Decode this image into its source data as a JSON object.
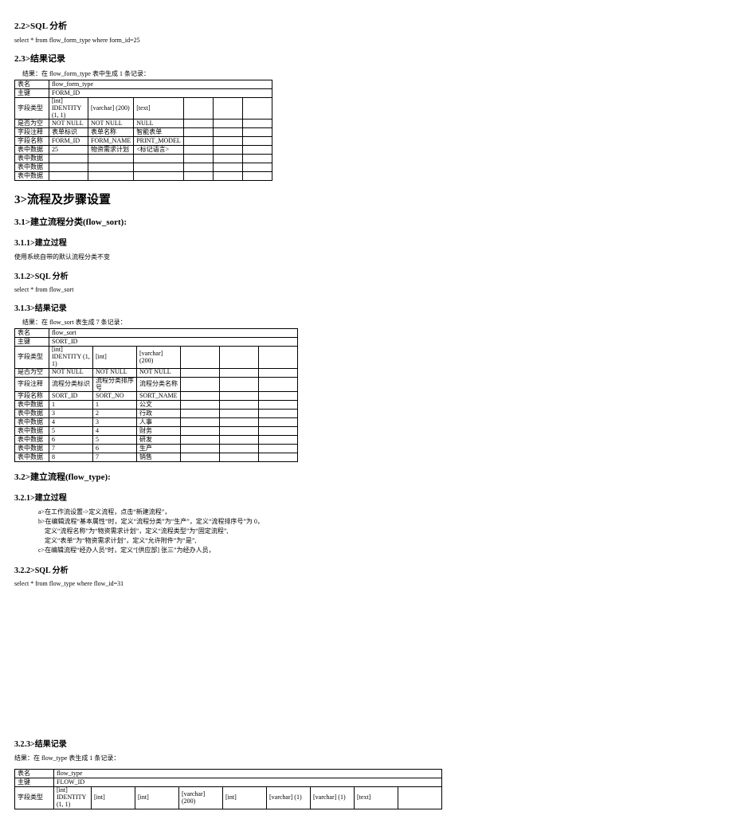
{
  "s22": {
    "title": "2.2>SQL 分析",
    "sql": "select * from flow_form_type where form_id=25"
  },
  "s23": {
    "title": "2.3>结果记录",
    "caption": "结果：在 flow_form_type 表中生成 1 条记录：",
    "rows": {
      "name": [
        "表名",
        "flow_form_type"
      ],
      "pk": [
        "主键",
        "FORM_ID"
      ],
      "type": [
        "字段类型",
        "[int] IDENTITY (1, 1)",
        "[varchar] (200)",
        "[text]",
        "",
        "",
        ""
      ],
      "null": [
        "是否为空",
        "NOT NULL",
        "NOT NULL",
        "NULL",
        "",
        "",
        ""
      ],
      "comm": [
        "字段注释",
        "表单标识",
        "表单名称",
        "智能表单",
        "",
        "",
        ""
      ],
      "field": [
        "字段名称",
        "FORM_ID",
        "FORM_NAME",
        "PRINT_MODEL",
        "",
        "",
        ""
      ],
      "data": [
        "表中数据",
        "25",
        "物资需求计划",
        "<标记语言>",
        "",
        "",
        ""
      ],
      "d2": [
        "表中数据",
        "",
        "",
        "",
        "",
        "",
        ""
      ],
      "d3": [
        "表中数据",
        "",
        "",
        "",
        "",
        "",
        ""
      ],
      "d4": [
        "表中数据",
        "",
        "",
        "",
        "",
        "",
        ""
      ]
    }
  },
  "s3": {
    "title": "3>流程及步骤设置"
  },
  "s31": {
    "title": "3.1>建立流程分类(flow_sort):"
  },
  "s311": {
    "title": "3.1.1>建立过程",
    "text": "使用系统自带的默认流程分类不变"
  },
  "s312": {
    "title": "3.1.2>SQL 分析",
    "sql": "select * from flow_sort"
  },
  "s313": {
    "title": "3.1.3>结果记录",
    "caption": "结果：在 flow_sort 表生成 7 条记录：",
    "rows": {
      "name": [
        "表名",
        "flow_sort"
      ],
      "pk": [
        "主键",
        "SORT_ID"
      ],
      "type": [
        "字段类型",
        "[int] IDENTITY (1, 1)",
        "[int]",
        "[varchar] (200)",
        "",
        "",
        ""
      ],
      "null": [
        "是否为空",
        "NOT NULL",
        "NOT NULL",
        "NOT NULL",
        "",
        "",
        ""
      ],
      "comm": [
        "字段注释",
        "流程分类标识",
        "流程分类排序号",
        "流程分类名称",
        "",
        "",
        ""
      ],
      "field": [
        "字段名称",
        "SORT_ID",
        "SORT_NO",
        "SORT_NAME",
        "",
        "",
        ""
      ],
      "r1": [
        "表中数据",
        "1",
        "1",
        "公文",
        "",
        "",
        ""
      ],
      "r2": [
        "表中数据",
        "3",
        "2",
        "行政",
        "",
        "",
        ""
      ],
      "r3": [
        "表中数据",
        "4",
        "3",
        "人事",
        "",
        "",
        ""
      ],
      "r4": [
        "表中数据",
        "5",
        "4",
        "财务",
        "",
        "",
        ""
      ],
      "r5": [
        "表中数据",
        "6",
        "5",
        "研发",
        "",
        "",
        ""
      ],
      "r6": [
        "表中数据",
        "7",
        "6",
        "生产",
        "",
        "",
        ""
      ],
      "r7": [
        "表中数据",
        "8",
        "7",
        "销售",
        "",
        "",
        ""
      ]
    }
  },
  "s32": {
    "title": "3.2>建立流程(flow_type):"
  },
  "s321": {
    "title": "3.2.1>建立过程",
    "lines": [
      "a>在工作流设置->定义流程，点击“新建流程”，",
      "b>在编辑流程“基本属性”时，定义“流程分类”为“生产”，定义“流程排序号”为 0，",
      "　定义“流程名称”为“物资需求计划”，定义“流程类型”为“固定流程”,",
      "　定义“表单”为“物资需求计划”，定义“允许附件”为“是”,",
      "c>在编辑流程“经办人员”时，定义“[供应部] 张三”为经办人员，"
    ]
  },
  "s322": {
    "title": "3.2.2>SQL 分析",
    "sql": "select * from flow_type where flow_id=31"
  },
  "s323": {
    "title": "3.2.3>结果记录",
    "caption": "结果：在 flow_type 表生成 1 条记录：",
    "rows": {
      "name": [
        "表名",
        "flow_type"
      ],
      "pk": [
        "主键",
        "FLOW_ID"
      ],
      "type": [
        "字段类型",
        "[int] IDENTITY (1, 1)",
        "[int]",
        "[int]",
        "[varchar] (200)",
        "[int]",
        "[varchar] (1)",
        "[varchar] (1)",
        "[text]",
        ""
      ]
    }
  }
}
